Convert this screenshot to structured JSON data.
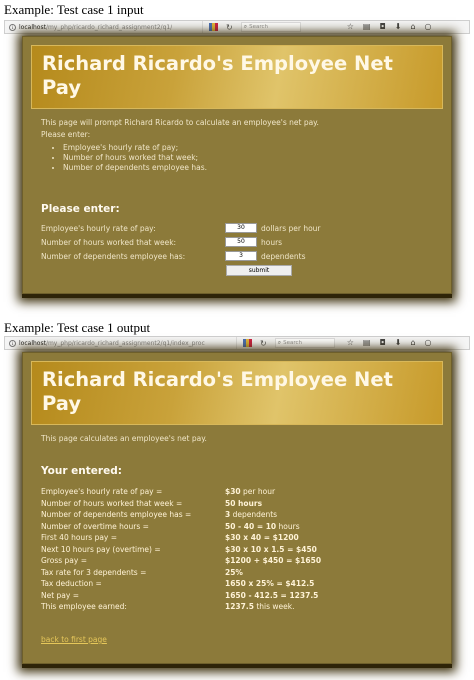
{
  "input_example": {
    "caption": "Example: Test case 1 input",
    "browser": {
      "url_host": "localhost",
      "url_path": "/my_php/ricardo_richard_assignment2/q1/",
      "search_placeholder": "Search",
      "icons": [
        "info-icon",
        "reader-icon",
        "reload-icon",
        "search-icon",
        "star-icon",
        "library-icon",
        "pocket-icon",
        "download-icon",
        "home-icon",
        "chat-icon"
      ]
    },
    "title": "Richard Ricardo's Employee Net Pay",
    "intro_line1": "This page will prompt Richard Ricardo to calculate an employee's net pay.",
    "intro_line2": "Please enter:",
    "bullets": [
      "Employee's hourly rate of pay;",
      "Number of hours worked that week;",
      "Number of dependents employee has."
    ],
    "form_heading": "Please enter:",
    "fields": [
      {
        "label": "Employee's hourly rate of pay:",
        "value": "30",
        "unit": "dollars per hour"
      },
      {
        "label": "Number of hours worked that week:",
        "value": "50",
        "unit": "hours"
      },
      {
        "label": "Number of dependents employee has:",
        "value": "3",
        "unit": "dependents"
      }
    ],
    "submit_label": "submit"
  },
  "output_example": {
    "caption": "Example: Test case 1 output",
    "browser": {
      "url_host": "localhost",
      "url_path": "/my_php/ricardo_richard_assignment2/q1/index_proc",
      "search_placeholder": "Search"
    },
    "title": "Richard Ricardo's Employee Net Pay",
    "intro": "This page calculates an employee's net pay.",
    "results_heading": "Your entered:",
    "results": [
      {
        "label": "Employee's hourly rate of pay =",
        "bold": "$30",
        "rest": " per hour"
      },
      {
        "label": "Number of hours worked that week =",
        "bold": "50 hours",
        "rest": ""
      },
      {
        "label": "Number of dependents employee has =",
        "bold": "3",
        "rest": " dependents"
      },
      {
        "label": "Number of overtime hours =",
        "bold": "50 - 40 = 10",
        "rest": " hours"
      },
      {
        "label": "First 40 hours pay =",
        "bold": "$30 x 40 = $1200",
        "rest": ""
      },
      {
        "label": "Next 10 hours pay (overtime) =",
        "bold": "$30 x 10 x 1.5 = $450",
        "rest": ""
      },
      {
        "label": "Gross pay =",
        "bold": "$1200 + $450 = $1650",
        "rest": ""
      },
      {
        "label": "Tax rate for 3 dependents =",
        "bold": "25%",
        "rest": ""
      },
      {
        "label": "Tax deduction =",
        "bold": "1650 x 25% = $412.5",
        "rest": ""
      },
      {
        "label": "Net pay =",
        "bold": "1650 - 412.5 = 1237.5",
        "rest": ""
      },
      {
        "label": "This employee earned:",
        "bold": "1237.5",
        "rest": " this week."
      }
    ],
    "back_link": "back to first page"
  }
}
